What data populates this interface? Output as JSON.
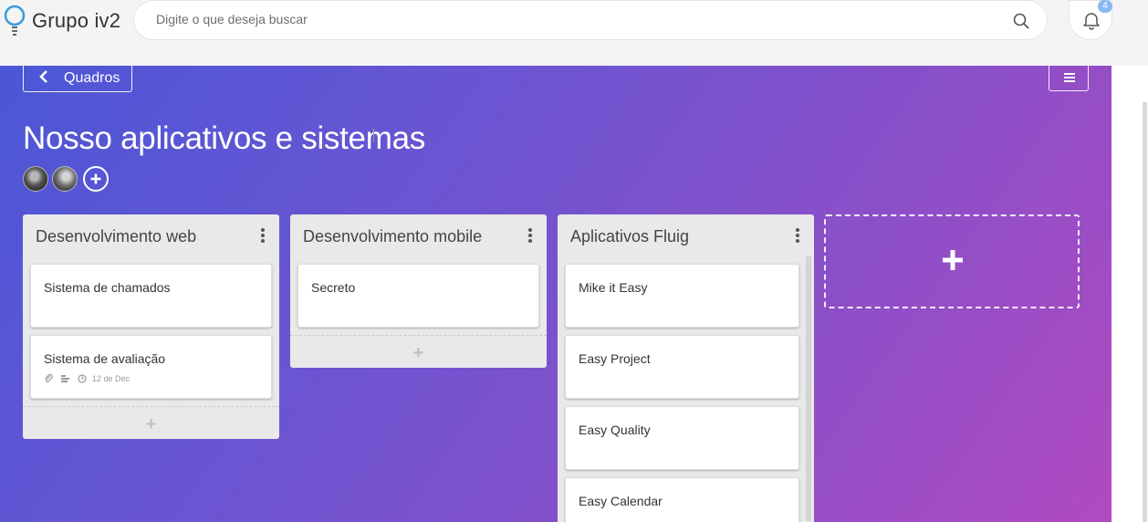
{
  "app": {
    "name": "Grupo iv2"
  },
  "search": {
    "placeholder": "Digite o que deseja buscar"
  },
  "notifications": {
    "count": "4"
  },
  "board": {
    "back_label": "Quadros",
    "title": "Nosso aplicativos e sistemas",
    "members_count": 2,
    "lists": [
      {
        "title": "Desenvolvimento web",
        "cards": [
          {
            "title": "Sistema de chamados"
          },
          {
            "title": "Sistema de avaliação",
            "due": "12 de Dec"
          }
        ]
      },
      {
        "title": "Desenvolvimento mobile",
        "cards": [
          {
            "title": "Secreto"
          }
        ]
      },
      {
        "title": "Aplicativos Fluig",
        "cards": [
          {
            "title": "Mike it Easy"
          },
          {
            "title": "Easy Project"
          },
          {
            "title": "Easy Quality"
          },
          {
            "title": "Easy Calendar"
          }
        ]
      }
    ],
    "add_card_symbol": "+",
    "colors": {
      "gradient_start": "#4b57d6",
      "gradient_end": "#b04ac1",
      "list_bg": "#e9e9e9"
    }
  }
}
